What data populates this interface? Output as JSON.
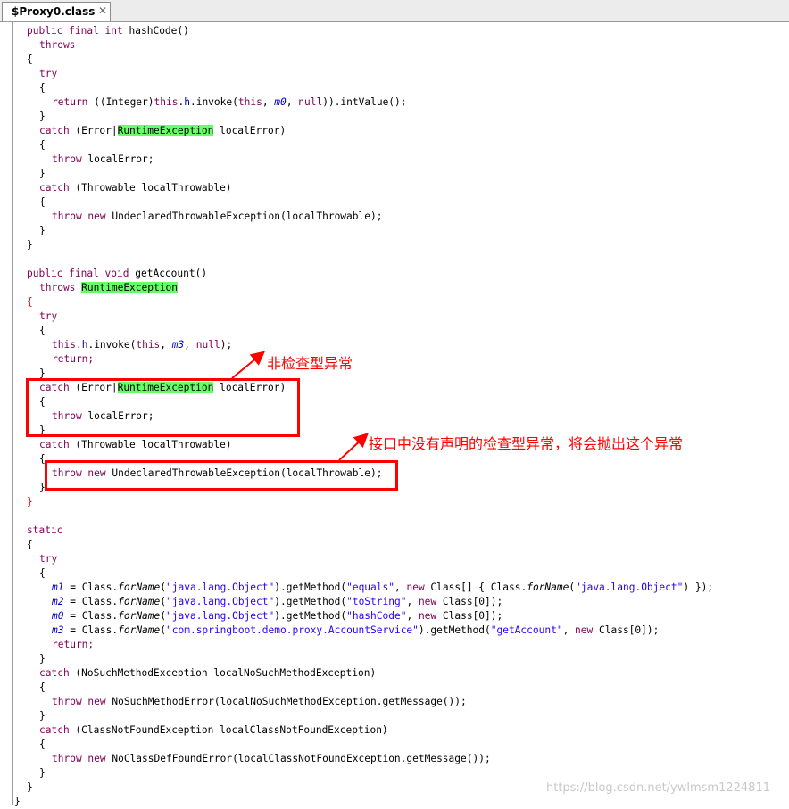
{
  "tab": {
    "title": "$Proxy0.class",
    "close": "✕"
  },
  "code": {
    "l1": {
      "a": "public final int",
      "b": " hashCode()"
    },
    "l2": "throws",
    "brace_open": "{",
    "brace_close": "}",
    "try": "try",
    "l5": {
      "a": "return",
      "b": " ((Integer)",
      "c": "this",
      "d": ".",
      "e": "h",
      "f": ".invoke(",
      "g": "this",
      "h": ", ",
      "i": "m0",
      "j": ", ",
      "k": "null",
      "l": ")).intValue();"
    },
    "catch_kw": "catch",
    "l7": {
      "b": " (Error|",
      "c": "RuntimeException",
      "d": " localError)"
    },
    "throw_kw": "throw",
    "l9": " localError;",
    "l11": " (Throwable localThrowable)",
    "l13": {
      "a": "throw new",
      "b": " UndeclaredThrowableException(localThrowable);"
    },
    "l17": {
      "a": "public final void",
      "b": " getAccount()"
    },
    "l18": {
      "a": "throws",
      "b": " ",
      "c": "RuntimeException"
    },
    "l22": {
      "a": "this",
      "b": ".",
      "c": "h",
      "d": ".invoke(",
      "e": "this",
      "f": ", ",
      "g": "m3",
      "h": ", ",
      "i": "null",
      "j": ");"
    },
    "l23": "return;",
    "l34": "static",
    "l38": {
      "a": "m1",
      "b": " = Class.",
      "c": "forName",
      "d": "(",
      "e": "\"java.lang.Object\"",
      "f": ").getMethod(",
      "g": "\"equals\"",
      "h": ", ",
      "i": "new",
      "j": " Class[] { Class.",
      "k": "forName",
      "l": "(",
      "m": "\"java.lang.Object\"",
      "n": ") });"
    },
    "l39": {
      "a": "m2",
      "b": " = Class.",
      "c": "forName",
      "d": "(",
      "e": "\"java.lang.Object\"",
      "f": ").getMethod(",
      "g": "\"toString\"",
      "h": ", ",
      "i": "new",
      "j": " Class[0]);"
    },
    "l40": {
      "a": "m0",
      "b": " = Class.",
      "c": "forName",
      "d": "(",
      "e": "\"java.lang.Object\"",
      "f": ").getMethod(",
      "g": "\"hashCode\"",
      "h": ", ",
      "i": "new",
      "j": " Class[0]);"
    },
    "l41": {
      "a": "m3",
      "b": " = Class.",
      "c": "forName",
      "d": "(",
      "e": "\"com.springboot.demo.proxy.AccountService\"",
      "f": ").getMethod(",
      "g": "\"getAccount\"",
      "h": ", ",
      "i": "new",
      "j": " Class[0]);"
    },
    "l44": " (NoSuchMethodException localNoSuchMethodException)",
    "l46": {
      "a": "throw new",
      "b": " NoSuchMethodError(localNoSuchMethodException.getMessage());"
    },
    "l48": " (ClassNotFoundException localClassNotFoundException)",
    "l50": {
      "a": "throw new",
      "b": " NoClassDefFoundError(localClassNotFoundException.getMessage());"
    }
  },
  "annotations": {
    "unchecked": "非检查型异常",
    "undeclared": "接口中没有声明的检查型异常，将会抛出这个异常"
  },
  "watermark": "https://blog.csdn.net/ywlmsm1224811",
  "colors": {
    "keyword": "#7f0055",
    "field": "#0000c0",
    "string": "#2a00ff",
    "highlight": "#66ff66",
    "annotation": "#ff0000"
  }
}
